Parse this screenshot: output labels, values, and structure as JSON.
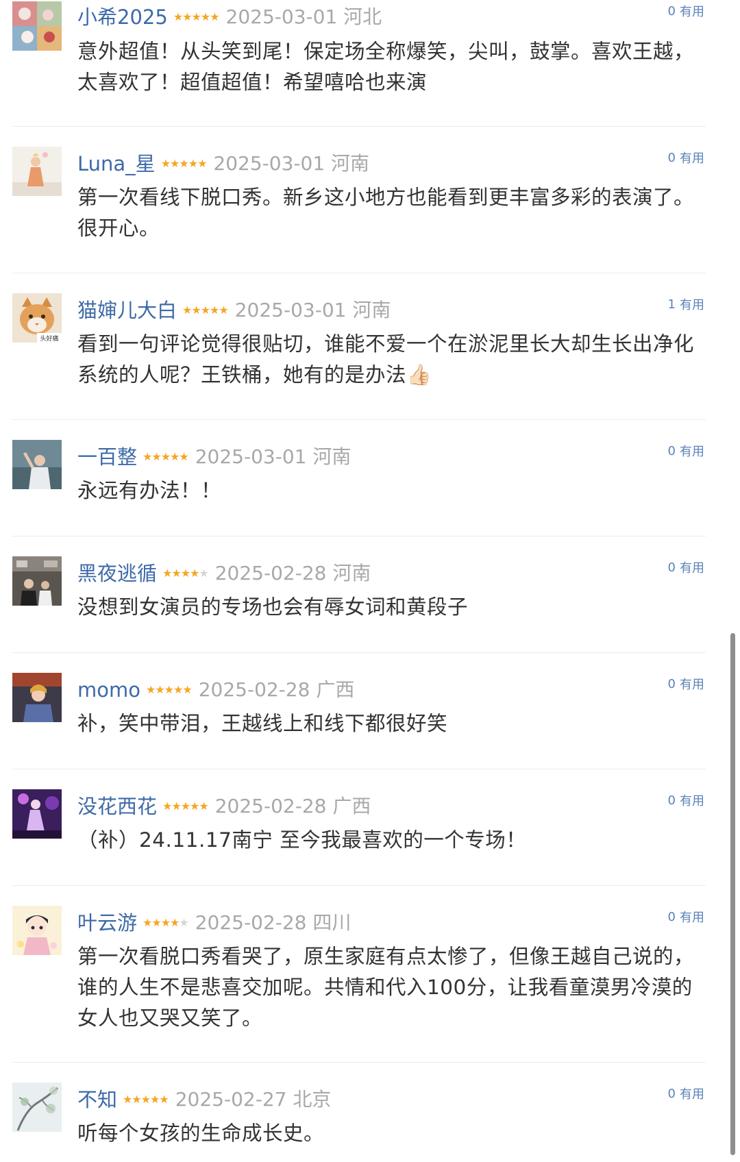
{
  "comments": [
    {
      "username": "小希2025",
      "rating": 5,
      "date": "2025-03-01",
      "location": "河北",
      "useful_count": "0",
      "useful_label": "有用",
      "text": "意外超值！从头笑到尾！保定场全称爆笑，尖叫，鼓掌。喜欢王越，太喜欢了！超值超值！希望嘻哈也来演",
      "avatar_icon": "avatar-floral-collage-icon"
    },
    {
      "username": "Luna_星",
      "rating": 5,
      "date": "2025-03-01",
      "location": "河南",
      "useful_count": "0",
      "useful_label": "有用",
      "text": "第一次看线下脱口秀。新乡这小地方也能看到更丰富多彩的表演了。很开心。",
      "avatar_icon": "avatar-figurine-icon"
    },
    {
      "username": "猫婶儿大白",
      "rating": 5,
      "date": "2025-03-01",
      "location": "河南",
      "useful_count": "1",
      "useful_label": "有用",
      "text": "看到一句评论觉得很贴切，谁能不爱一个在淤泥里长大却生长出净化系统的人呢？王铁桶，她有的是办法👍🏻",
      "avatar_icon": "avatar-cat-icon",
      "avatar_caption": "头好痛"
    },
    {
      "username": "一百整",
      "rating": 5,
      "date": "2025-03-01",
      "location": "河南",
      "useful_count": "0",
      "useful_label": "有用",
      "text": "永远有办法！！",
      "avatar_icon": "avatar-person-waving-icon"
    },
    {
      "username": "黑夜逃循",
      "rating": 4,
      "date": "2025-02-28",
      "location": "河南",
      "useful_count": "0",
      "useful_label": "有用",
      "text": "没想到女演员的专场也会有辱女词和黄段子",
      "avatar_icon": "avatar-indoor-photo-icon"
    },
    {
      "username": "momo",
      "rating": 5,
      "date": "2025-02-28",
      "location": "广西",
      "useful_count": "0",
      "useful_label": "有用",
      "text": "补，笑中带泪，王越线上和线下都很好笑",
      "avatar_icon": "avatar-woman-photo-icon"
    },
    {
      "username": "没花西花",
      "rating": 5,
      "date": "2025-02-28",
      "location": "广西",
      "useful_count": "0",
      "useful_label": "有用",
      "text": "（补）24.11.17南宁 至今我最喜欢的一个专场！",
      "avatar_icon": "avatar-neon-figure-icon"
    },
    {
      "username": "叶云游",
      "rating": 4,
      "date": "2025-02-28",
      "location": "四川",
      "useful_count": "0",
      "useful_label": "有用",
      "text": "第一次看脱口秀看哭了，原生家庭有点太惨了，但像王越自己说的，谁的人生不是悲喜交加呢。共情和代入100分，让我看童漠男冷漠的女人也又哭又笑了。",
      "avatar_icon": "avatar-anime-girl-icon"
    },
    {
      "username": "不知",
      "rating": 5,
      "date": "2025-02-27",
      "location": "北京",
      "useful_count": "0",
      "useful_label": "有用",
      "text": "听每个女孩的生命成长史。",
      "avatar_icon": "avatar-snowy-tree-icon"
    }
  ],
  "colors": {
    "username": "#3d6aa8",
    "star_on": "#f5a623",
    "star_off": "#d5d5d5",
    "meta_gray": "#a8a8a8",
    "useful": "#5b82b8",
    "text": "#333333"
  }
}
